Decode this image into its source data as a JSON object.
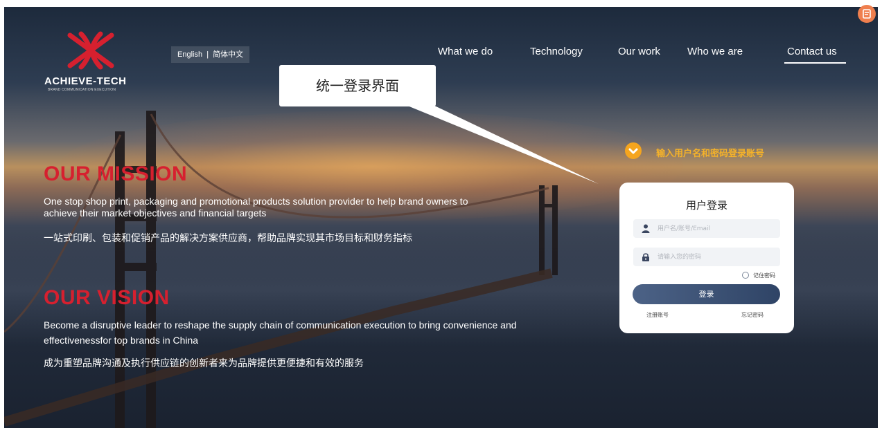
{
  "brand": {
    "name": "ACHIEVE-TECH",
    "tagline": "BRAND COMMUNICATION EXECUTION",
    "logo_color": "#d6202f"
  },
  "language_switch": "English  |  简体中文",
  "nav": {
    "items": [
      "What we do",
      "Technology",
      "Our work",
      "Who we are",
      "Contact us"
    ],
    "active": "Contact us"
  },
  "callout": {
    "text": "统一登录界面"
  },
  "mission": {
    "heading": "OUR MISSION",
    "en": "One stop shop print, packaging and promotional products solution provider to help brand owners to achieve their market objectives and financial targets",
    "cn": "一站式印刷、包装和促销产品的解决方案供应商，帮助品牌实现其市场目标和财务指标"
  },
  "vision": {
    "heading": "OUR VISION",
    "en": "Become a disruptive leader to reshape the supply chain of communication execution to bring convenience and effectivenessfor top brands in China",
    "cn": "成为重塑品牌沟通及执行供应链的创新者来为品牌提供更便捷和有效的服务"
  },
  "login_hint": "输入用户名和密码登录账号",
  "login": {
    "title": "用户登录",
    "username_placeholder": "用户名/账号/Email",
    "password_placeholder": "请输入您的密码",
    "remember": "记住密码",
    "submit": "登录",
    "register": "注册账号",
    "forgot": "忘记密码"
  },
  "icons": {
    "user": "user-icon",
    "lock": "lock-icon",
    "hint": "chevron-down-icon",
    "corner": "chat-icon"
  },
  "colors": {
    "accent_red": "#d6202f",
    "hint_orange": "#f5a51e",
    "button_blue": "#3c5276",
    "corner_orange": "#ef7f4e"
  }
}
